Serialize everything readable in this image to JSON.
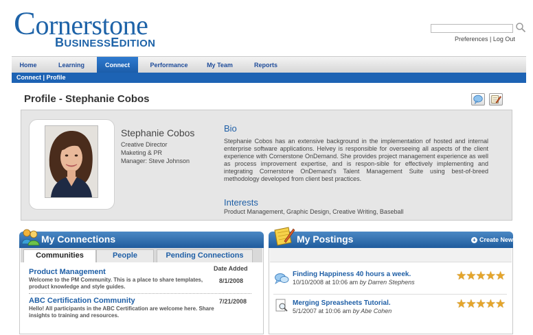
{
  "logo": {
    "first_letter": "C",
    "rest": "ornerstone",
    "edition_b": "B",
    "edition_usiness": "USINESS",
    "edition_e": "E",
    "edition_dition": "DITION"
  },
  "header": {
    "preferences": "Preferences",
    "separator": "|",
    "logout": "Log Out"
  },
  "nav": {
    "tabs": [
      "Home",
      "Learning",
      "Connect",
      "Performance",
      "My Team",
      "Reports"
    ],
    "active": "Connect"
  },
  "breadcrumb": "Connect | Profile",
  "page_title": "Profile - Stephanie Cobos",
  "profile": {
    "name": "Stephanie Cobos",
    "title": "Creative Director",
    "department": "Maketing & PR",
    "manager": "Manager: Steve Johnson",
    "bio_heading": "Bio",
    "bio_text": "Stephanie Cobos has an extensive background in the implementation of hosted and internal enterprise software applications. Helvey is responsible for overseeing all aspects of the client experience with Cornerstone OnDemand. She provides project management experience as well as process improvement expertise, and is respon-sible for effectively implementing and integrating Cornerstone OnDemand's Talent Management Suite using best-of-breed methodology developed from client best practices.",
    "interests_heading": "Interests",
    "interests_text": "Product Management, Graphic Design, Creative Writing, Baseball"
  },
  "connections": {
    "title": "My Connections",
    "tabs": [
      "Communities",
      "People",
      "Pending Connections"
    ],
    "active_tab": "Communities",
    "date_added_label": "Date Added",
    "items": [
      {
        "title": "Product Management",
        "desc": "Welcome to the PM Community. This is a place to share templates, product knowledge and style guides.",
        "date": "8/1/2008"
      },
      {
        "title": "ABC Certification Community",
        "desc": "Hello! All participants in the ABC Certification are welcome here. Share insights to training and resources.",
        "date": "7/21/2008"
      }
    ]
  },
  "postings": {
    "title": "My Postings",
    "create_new": "Create New",
    "items": [
      {
        "title": "Finding Happiness 40 hours a week.",
        "date": "10/10/2008 at 10:06 am",
        "by": "by Darren Stephens",
        "rating": 5,
        "icon": "speech-bubbles-icon"
      },
      {
        "title": "Merging Spreasheets Tutorial.",
        "date": "5/1/2007 at 10:06 am",
        "by": "by Abe Cohen",
        "rating": 5,
        "icon": "document-magnifier-icon"
      }
    ]
  },
  "colors": {
    "brand": "#1e63a8",
    "nav_active": "#1d63b4",
    "panel_header": "#2f6fae",
    "star": "#e5a52a"
  }
}
